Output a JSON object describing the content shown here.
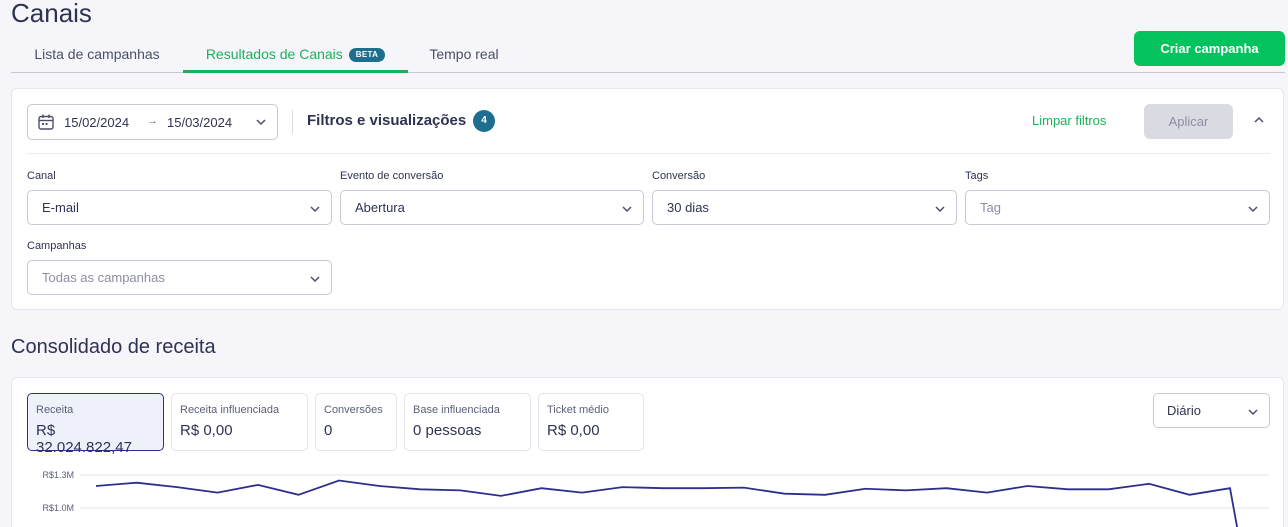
{
  "page": {
    "title": "Canais"
  },
  "tabs": [
    {
      "label": "Lista de campanhas"
    },
    {
      "label": "Resultados de Canais",
      "badge": "BETA"
    },
    {
      "label": "Tempo real"
    }
  ],
  "header": {
    "create_button": "Criar campanha"
  },
  "filters": {
    "date_start": "15/02/2024",
    "date_end": "15/03/2024",
    "title": "Filtros e visualizações",
    "count": "4",
    "clear_label": "Limpar filtros",
    "apply_label": "Aplicar",
    "fields": {
      "channel": {
        "label": "Canal",
        "value": "E-mail"
      },
      "conversion_event": {
        "label": "Evento de conversão",
        "value": "Abertura"
      },
      "conversion": {
        "label": "Conversão",
        "value": "30 dias"
      },
      "tags": {
        "label": "Tags",
        "placeholder": "Tag"
      },
      "campaigns": {
        "label": "Campanhas",
        "placeholder": "Todas as campanhas"
      }
    }
  },
  "revenue": {
    "title": "Consolidado de receita",
    "period": "Diário",
    "metrics": [
      {
        "label": "Receita",
        "value": "R$ 32.024.822,47"
      },
      {
        "label": "Receita influenciada",
        "value": "R$ 0,00"
      },
      {
        "label": "Conversões",
        "value": "0"
      },
      {
        "label": "Base influenciada",
        "value": "0 pessoas"
      },
      {
        "label": "Ticket médio",
        "value": "R$ 0,00"
      }
    ]
  },
  "colors": {
    "accent": "#19b25a",
    "primary_button": "#04c25e",
    "badge": "#1e6f8f",
    "line": "#2c2f8c"
  },
  "chart_data": {
    "type": "line",
    "y_ticks": [
      "R$1.3M",
      "R$1.0M"
    ],
    "y_tick_values": [
      1300000,
      1000000
    ],
    "series": [
      {
        "values": [
          1200000,
          1230000,
          1190000,
          1140000,
          1210000,
          1120000,
          1250000,
          1200000,
          1170000,
          1160000,
          1110000,
          1180000,
          1140000,
          1190000,
          1180000,
          1180000,
          1185000,
          1130000,
          1120000,
          1175000,
          1160000,
          1180000,
          1140000,
          1200000,
          1170000,
          1170000,
          1220000,
          1120000,
          1180000,
          600000
        ]
      }
    ]
  }
}
